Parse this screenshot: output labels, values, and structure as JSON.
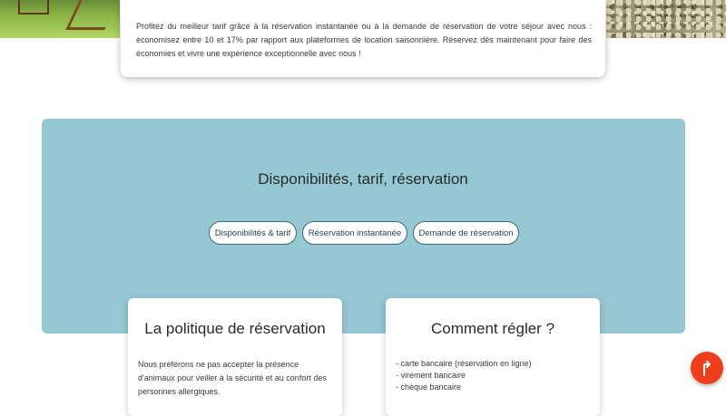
{
  "intro": {
    "text": "Profitez du meilleur tarif grâce à la réservation instantanée ou à la demande de réservation de votre séjour avec nous : économisez entre 10 et 17% par rapport aux plateformes de location saisonnière. Réservez dès maintenant pour faire des économies et vivre une expérience exceptionnelle avec nous !"
  },
  "booking": {
    "title": "Disponibilités, tarif, réservation",
    "buttons": [
      {
        "label": "Disponibilités & tarif"
      },
      {
        "label": "Réservation instantanée"
      },
      {
        "label": "Demande de réservation"
      }
    ]
  },
  "policy": {
    "title": "La politique de réservation",
    "text": "Nous préférons ne pas accepter la présence d'animaux pour veiller à la sécurité et au confort des personnes allergiques."
  },
  "payment": {
    "title": "Comment régler ?",
    "items": [
      "- carte bancaire (réservation en ligne)",
      "- virement bancaire",
      "- chèque bancaire"
    ]
  },
  "fab": {
    "icon": "arrow-up-icon"
  },
  "colors": {
    "band": "#96c8d3",
    "fab": "#ef3e1c",
    "button_border": "#3c6b76"
  }
}
